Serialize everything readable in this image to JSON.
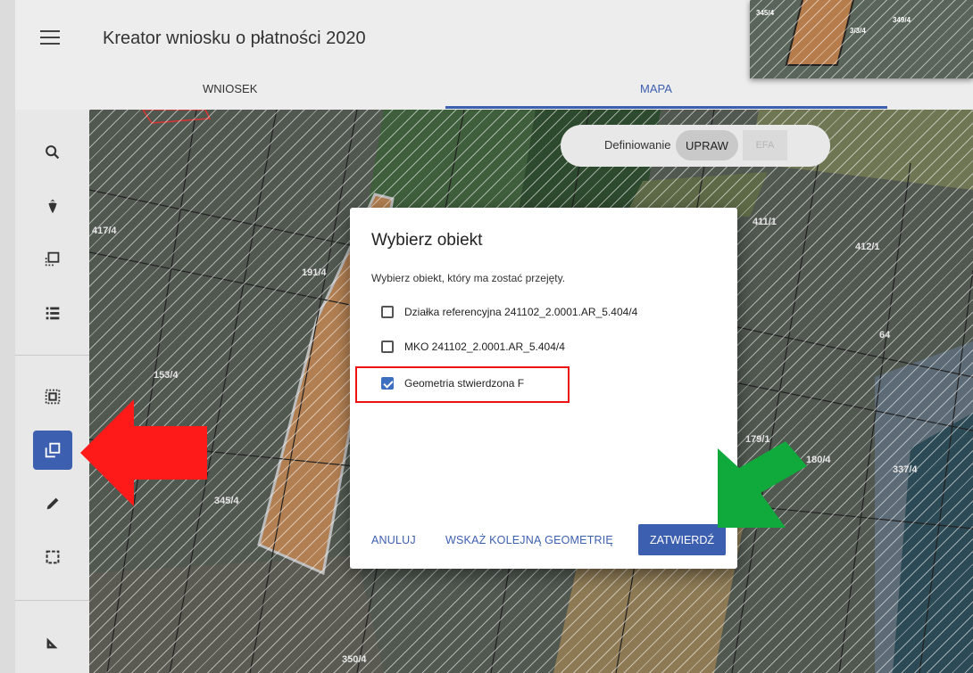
{
  "app": {
    "title": "Kreator wniosku o płatności 2020"
  },
  "tabs": [
    {
      "label": "WNIOSEK"
    },
    {
      "label": "MAPA",
      "active": true
    }
  ],
  "sidebar": {
    "items": [
      {
        "icon": "search-icon"
      },
      {
        "icon": "crop-beet-icon"
      },
      {
        "icon": "select-object-icon"
      },
      {
        "icon": "list-icon"
      },
      {
        "icon": "select-area-icon"
      },
      {
        "icon": "copy-geometry-icon",
        "active": true
      },
      {
        "icon": "pencil-icon"
      },
      {
        "icon": "select-rectangle-icon"
      },
      {
        "icon": "measure-icon"
      }
    ]
  },
  "definiowanie": {
    "label": "Definiowanie",
    "options": [
      "UPRAW",
      "EFA"
    ],
    "selected": "UPRAW"
  },
  "minimap": {
    "labels": [
      "345/4",
      "349/4",
      "3/3/4"
    ]
  },
  "map_labels": [
    "417/4",
    "191/4",
    "153/4",
    "345/4",
    "411/1",
    "412/1",
    "64",
    "179/1",
    "180/4",
    "337/4",
    "350/4"
  ],
  "dialog": {
    "title": "Wybierz obiekt",
    "subtitle": "Wybierz obiekt, który ma zostać przejęty.",
    "options": [
      {
        "label": "Działka referencyjna 241102_2.0001.AR_5.404/4",
        "checked": false
      },
      {
        "label": "MKO 241102_2.0001.AR_5.404/4",
        "checked": false
      },
      {
        "label": "Geometria stwierdzona F",
        "checked": true
      }
    ],
    "buttons": {
      "cancel": "ANULUJ",
      "next": "WSKAŻ KOLEJNĄ GEOMETRIĘ",
      "confirm": "ZATWIERDŹ"
    }
  },
  "colors": {
    "accent": "#3d5fb0",
    "highlight": "#ee1111",
    "arrow_red": "#ff1a1a",
    "arrow_green": "#10a93c"
  }
}
